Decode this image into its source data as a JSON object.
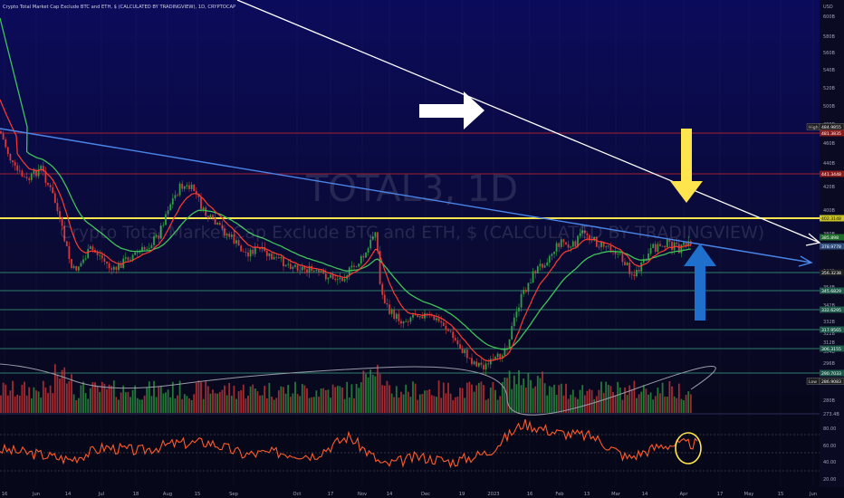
{
  "header": {
    "title": "Crypto Total Market Cap Exclude BTC and ETH, $ (CALCULATED BY TRADINGVIEW), 1D, CRYPTOCAP"
  },
  "watermark": {
    "symbol": "TOTAL3, 1D",
    "description": "Crypto Total Market Cap Exclude BTC and ETH, $ (CALCULATED BY TRADINGVIEW)"
  },
  "price_axis": {
    "unit": "USD",
    "ticks": [
      "600B",
      "580B",
      "560B",
      "540B",
      "520B",
      "500B",
      "480B",
      "460B",
      "440B",
      "420B",
      "400B",
      "380B",
      "366B",
      "354B",
      "342B",
      "332B",
      "322B",
      "312B",
      "304B",
      "296B",
      "288B",
      "280B",
      "273.4B"
    ]
  },
  "price_labels": [
    {
      "name": "high-tag",
      "prefix": "High",
      "text": "484.9855",
      "color": "#1e1e1e",
      "border": "#888888"
    },
    {
      "name": "level-481",
      "text": "481.3835",
      "color": "#8b1a1a"
    },
    {
      "name": "level-441",
      "text": "441.3448",
      "color": "#8b1a1a"
    },
    {
      "name": "level-402",
      "text": "402.3148",
      "color": "#c9c225",
      "textColor": "#111111"
    },
    {
      "name": "current-price",
      "text": "385.898",
      "color": "#1f6b2a"
    },
    {
      "name": "level-378",
      "text": "378.9778",
      "color": "#2c4a7a"
    },
    {
      "name": "level-356",
      "text": "356.3238",
      "color": "#1e1e1e"
    },
    {
      "name": "level-345",
      "text": "345.6829",
      "color": "#1e5a4a"
    },
    {
      "name": "level-332",
      "text": "332.6295",
      "color": "#1e5a4a"
    },
    {
      "name": "level-317",
      "text": "317.9565",
      "color": "#1e5a4a"
    },
    {
      "name": "level-306",
      "text": "306.3155",
      "color": "#1e5a4a"
    },
    {
      "name": "level-290",
      "text": "290.7033",
      "color": "#1e5a4a"
    },
    {
      "name": "low-tag",
      "prefix": "Low",
      "text": "286.9083",
      "color": "#1e1e1e",
      "border": "#888888"
    }
  ],
  "time_axis": {
    "labels": [
      "16",
      "Jun",
      "14",
      "Jul",
      "18",
      "Aug",
      "15",
      "Sep",
      "Oct",
      "17",
      "Nov",
      "14",
      "Dec",
      "19",
      "2023",
      "16",
      "Feb",
      "13",
      "Mar",
      "14",
      "Apr",
      "17",
      "May",
      "15",
      "Jun"
    ]
  },
  "rsi_axis": {
    "ticks": [
      "80.00",
      "60.00",
      "40.00",
      "20.00"
    ]
  },
  "colors": {
    "background_top": "#0a0a55",
    "background_bottom": "#07071d",
    "up": "#2f9e44",
    "down": "#d43a3a",
    "ema_fast": "#ff3b30",
    "ema_slow": "#3fc35a",
    "trend_white": "#ffffff",
    "trend_blue": "#4a86e8",
    "hline_yellow": "#ffe54d",
    "hline_red": "#a02030",
    "hline_green": "#2f7e6a",
    "rsi_line": "#ff5a2a",
    "rsi_circle": "#ffe54d",
    "arrow_white": "#ffffff",
    "arrow_yellow": "#ffe54d",
    "arrow_blue": "#1f6fcc"
  },
  "chart_data": {
    "type": "candlestick",
    "title": "Crypto Total Market Cap Exclude BTC and ETH, $ (CALCULATED BY TRADINGVIEW), 1D, CRYPTOCAP",
    "ylabel": "USD",
    "ylim": [
      270,
      600
    ],
    "scale": "log",
    "closes_approx": [
      {
        "x": "16",
        "y": 420
      },
      {
        "x": "Jun",
        "y": 410
      },
      {
        "x": "14",
        "y": 355
      },
      {
        "x": "Jul",
        "y": 352
      },
      {
        "x": "18",
        "y": 372
      },
      {
        "x": "Aug",
        "y": 384
      },
      {
        "x": "15",
        "y": 400
      },
      {
        "x": "Sep",
        "y": 366
      },
      {
        "x": "Oct",
        "y": 362
      },
      {
        "x": "17",
        "y": 356
      },
      {
        "x": "Nov",
        "y": 385
      },
      {
        "x": "14",
        "y": 322
      },
      {
        "x": "Dec",
        "y": 318
      },
      {
        "x": "19",
        "y": 292
      },
      {
        "x": "2023",
        "y": 305
      },
      {
        "x": "16",
        "y": 346
      },
      {
        "x": "Feb",
        "y": 382
      },
      {
        "x": "13",
        "y": 378
      },
      {
        "x": "Mar",
        "y": 376
      },
      {
        "x": "14",
        "y": 356
      },
      {
        "x": "Apr",
        "y": 386
      }
    ],
    "horizontal_levels": [
      481.3835,
      441.3448,
      402.3148,
      356.3238,
      345.6829,
      332.6295,
      317.9565,
      306.3155,
      290.7033
    ],
    "high": 484.9855,
    "low": 286.9083,
    "rsi": {
      "levels": [
        80,
        60,
        40,
        20
      ],
      "approx_values": [
        52,
        46,
        38,
        55,
        50,
        60,
        62,
        45,
        48,
        44,
        70,
        30,
        42,
        35,
        48,
        88,
        75,
        70,
        40,
        58,
        60
      ]
    }
  }
}
